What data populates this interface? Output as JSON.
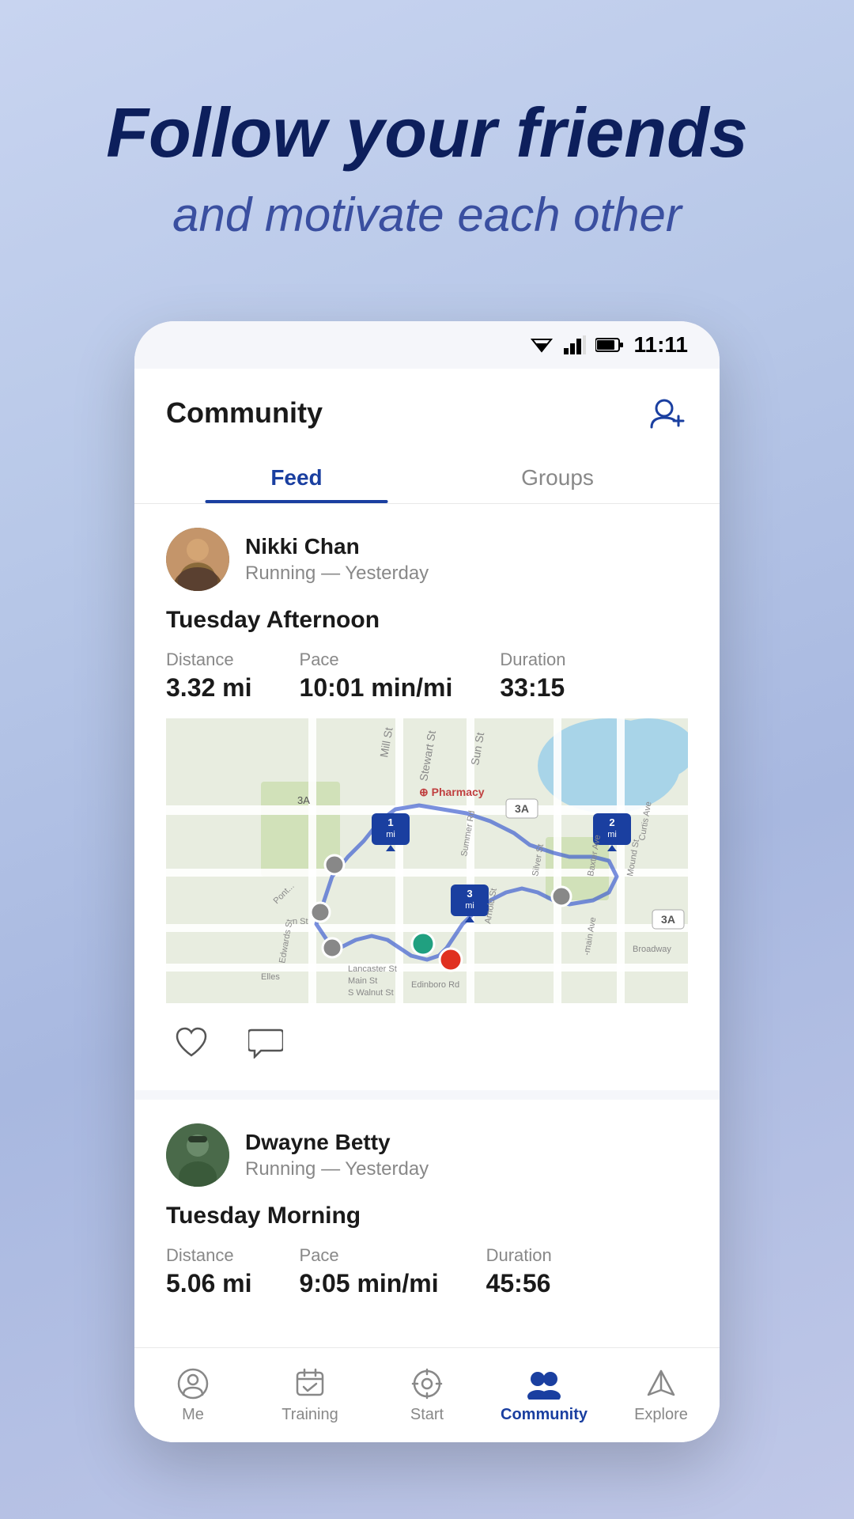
{
  "promo": {
    "title": "Follow your friends",
    "subtitle": "and motivate each other"
  },
  "status_bar": {
    "time": "11:11"
  },
  "header": {
    "title": "Community",
    "add_friend_label": "Add friend"
  },
  "tabs": [
    {
      "label": "Feed",
      "active": true
    },
    {
      "label": "Groups",
      "active": false
    }
  ],
  "feed": {
    "cards": [
      {
        "user_name": "Nikki Chan",
        "user_meta": "Running — Yesterday",
        "activity_title": "Tuesday Afternoon",
        "stats": [
          {
            "label": "Distance",
            "value": "3.32 mi"
          },
          {
            "label": "Pace",
            "value": "10:01 min/mi"
          },
          {
            "label": "Duration",
            "value": "33:15"
          }
        ]
      },
      {
        "user_name": "Dwayne Betty",
        "user_meta": "Running — Yesterday",
        "activity_title": "Tuesday Morning",
        "stats": [
          {
            "label": "Distance",
            "value": "5.06 mi"
          },
          {
            "label": "Pace",
            "value": "9:05 min/mi"
          },
          {
            "label": "Duration",
            "value": "45:56"
          }
        ]
      }
    ]
  },
  "bottom_nav": {
    "items": [
      {
        "label": "Me",
        "active": false
      },
      {
        "label": "Training",
        "active": false
      },
      {
        "label": "Start",
        "active": false
      },
      {
        "label": "Community",
        "active": true
      },
      {
        "label": "Explore",
        "active": false
      }
    ]
  }
}
